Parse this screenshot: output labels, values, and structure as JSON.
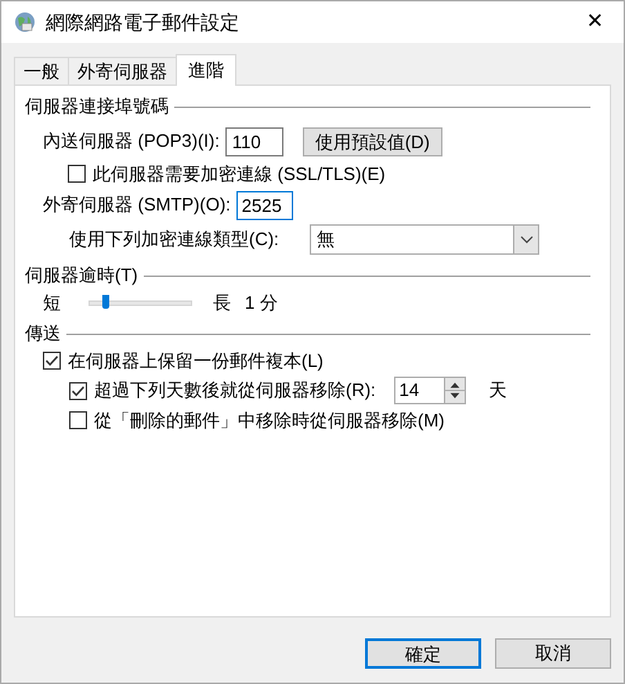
{
  "window": {
    "title": "網際網路電子郵件設定",
    "close": "✕"
  },
  "tabs": [
    {
      "label": "一般",
      "selected": false
    },
    {
      "label": "外寄伺服器",
      "selected": false
    },
    {
      "label": "進階",
      "selected": true
    }
  ],
  "ports": {
    "title": "伺服器連接埠號碼",
    "incoming": {
      "label": "內送伺服器 (POP3)(I):",
      "value": "110",
      "button": "使用預設值(D)"
    },
    "ssl": {
      "label": "此伺服器需要加密連線 (SSL/TLS)(E)",
      "checked": false
    },
    "outgoing": {
      "label": "外寄伺服器 (SMTP)(O):",
      "value": "2525",
      "focused": true
    },
    "encryption": {
      "label": "使用下列加密連線類型(C):",
      "value": "無"
    }
  },
  "timeout": {
    "title": "伺服器逾時(T)",
    "short": "短",
    "long": "長",
    "reading": "1 分",
    "level": 0.12
  },
  "delivery": {
    "title": "傳送",
    "leave_copy": {
      "label": "在伺服器上保留一份郵件複本(L)",
      "checked": true
    },
    "remove_after": {
      "label": "超過下列天數後就從伺服器移除(R):",
      "checked": true,
      "value": "14",
      "unit": "天"
    },
    "remove_deleted": {
      "label": "從「刪除的郵件」中移除時從伺服器移除(M)",
      "checked": false
    }
  },
  "buttons": [
    {
      "label": "確定",
      "default": true
    },
    {
      "label": "取消",
      "default": false
    }
  ]
}
